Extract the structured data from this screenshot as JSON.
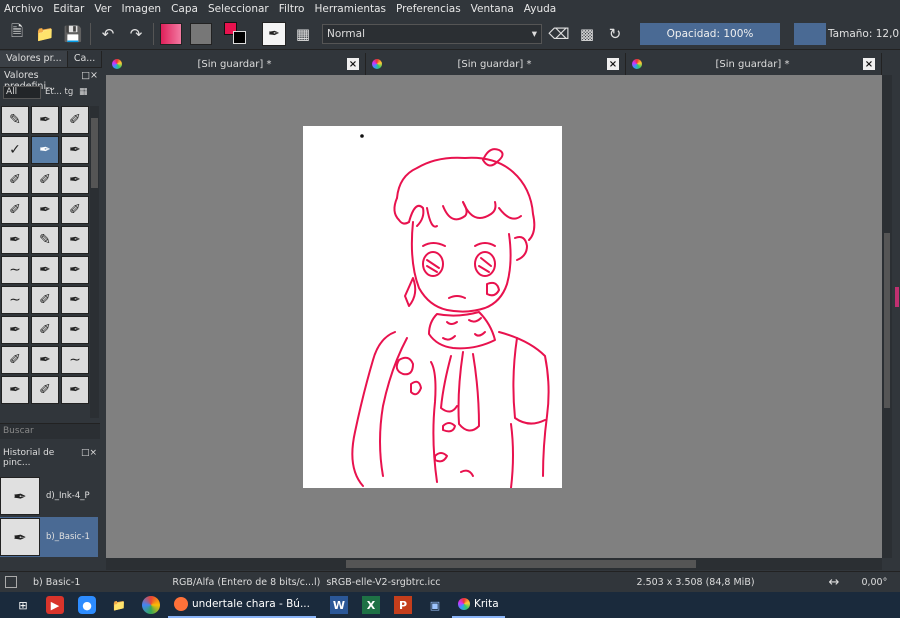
{
  "menu": [
    "Archivo",
    "Editar",
    "Ver",
    "Imagen",
    "Capa",
    "Seleccionar",
    "Filtro",
    "Herramientas",
    "Preferencias",
    "Ventana",
    "Ayuda"
  ],
  "toolbar": {
    "blend_mode": "Normal",
    "opacity_label": "Opacidad: 100%",
    "size_label": "Tamaño: 12,0",
    "colors": {
      "foreground": "#e8124e",
      "background": "#000000",
      "accent": "#4a6a94"
    }
  },
  "left_panel": {
    "tabs": [
      "Valores pr...",
      "Ca..."
    ],
    "presets_title": "Valores predefini...",
    "filter_value": "All",
    "tag_label": "Et...",
    "tag_short": "tg",
    "search_placeholder": "Buscar",
    "history_title": "Historial de pinc...",
    "history": [
      {
        "label": "d)_Ink-4_P",
        "icon": "pen-nib-icon"
      },
      {
        "label": "b)_Basic-1",
        "icon": "pen-nib-icon",
        "selected": true
      }
    ]
  },
  "documents": [
    {
      "title": "[Sin guardar]",
      "modified": "*"
    },
    {
      "title": "[Sin guardar]",
      "modified": "*"
    },
    {
      "title": "[Sin guardar]",
      "modified": "*"
    }
  ],
  "status": {
    "brush": "b) Basic-1",
    "color_model": "RGB/Alfa (Entero de 8 bits/c...l)",
    "profile": "sRGB-elle-V2-srgbtrc.icc",
    "size": "2.503 x 3.508 (84,8 MiB)",
    "rotation": "0,00°"
  },
  "taskbar": {
    "browser_task": "undertale chara - Bú...",
    "krita_task": "Krita",
    "word": "W",
    "excel": "X",
    "powerpoint": "P"
  },
  "drawing_color": "#e8124e"
}
